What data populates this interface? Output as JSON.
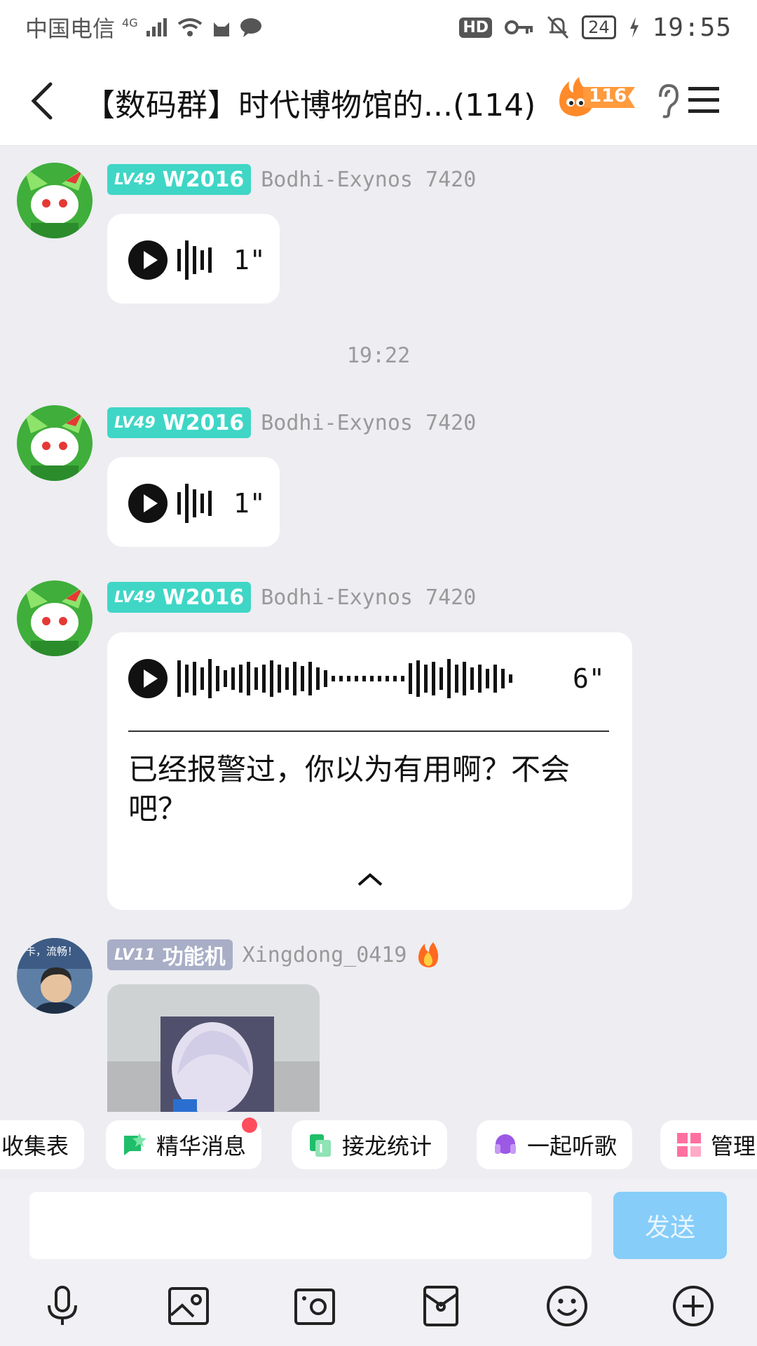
{
  "status_bar": {
    "carrier": "中国电信",
    "network": "4G",
    "battery": "24",
    "time": "19:55"
  },
  "header": {
    "title": "【数码群】时代博物馆的...(114)",
    "fire_count": "116"
  },
  "messages": [
    {
      "level": "LV49",
      "title": "W2016",
      "nickname": "Bodhi-Exynos 7420",
      "type": "voice",
      "duration": "1\""
    },
    {
      "timestamp": "19:22"
    },
    {
      "level": "LV49",
      "title": "W2016",
      "nickname": "Bodhi-Exynos 7420",
      "type": "voice",
      "duration": "1\""
    },
    {
      "level": "LV49",
      "title": "W2016",
      "nickname": "Bodhi-Exynos 7420",
      "type": "voice",
      "duration": "6\"",
      "transcript": "已经报警过，你以为有用啊？不会吧？"
    },
    {
      "level": "LV11",
      "title": "功能机",
      "nickname": "Xingdong_0419",
      "type": "image"
    }
  ],
  "avatar_caption": "卡，流畅！",
  "shortcuts": [
    "收集表",
    "精华消息",
    "接龙统计",
    "一起听歌",
    "管理"
  ],
  "input": {
    "placeholder": "",
    "send_label": "发送"
  },
  "colors": {
    "level_teal": "#3fd6c6",
    "level_gray": "#a9aec7",
    "send_bg": "#86cdfa",
    "chat_bg": "#ededf2"
  },
  "toolbar_icons": [
    "microphone-icon",
    "image-icon",
    "camera-icon",
    "red-packet-icon",
    "emoji-icon",
    "plus-icon"
  ]
}
